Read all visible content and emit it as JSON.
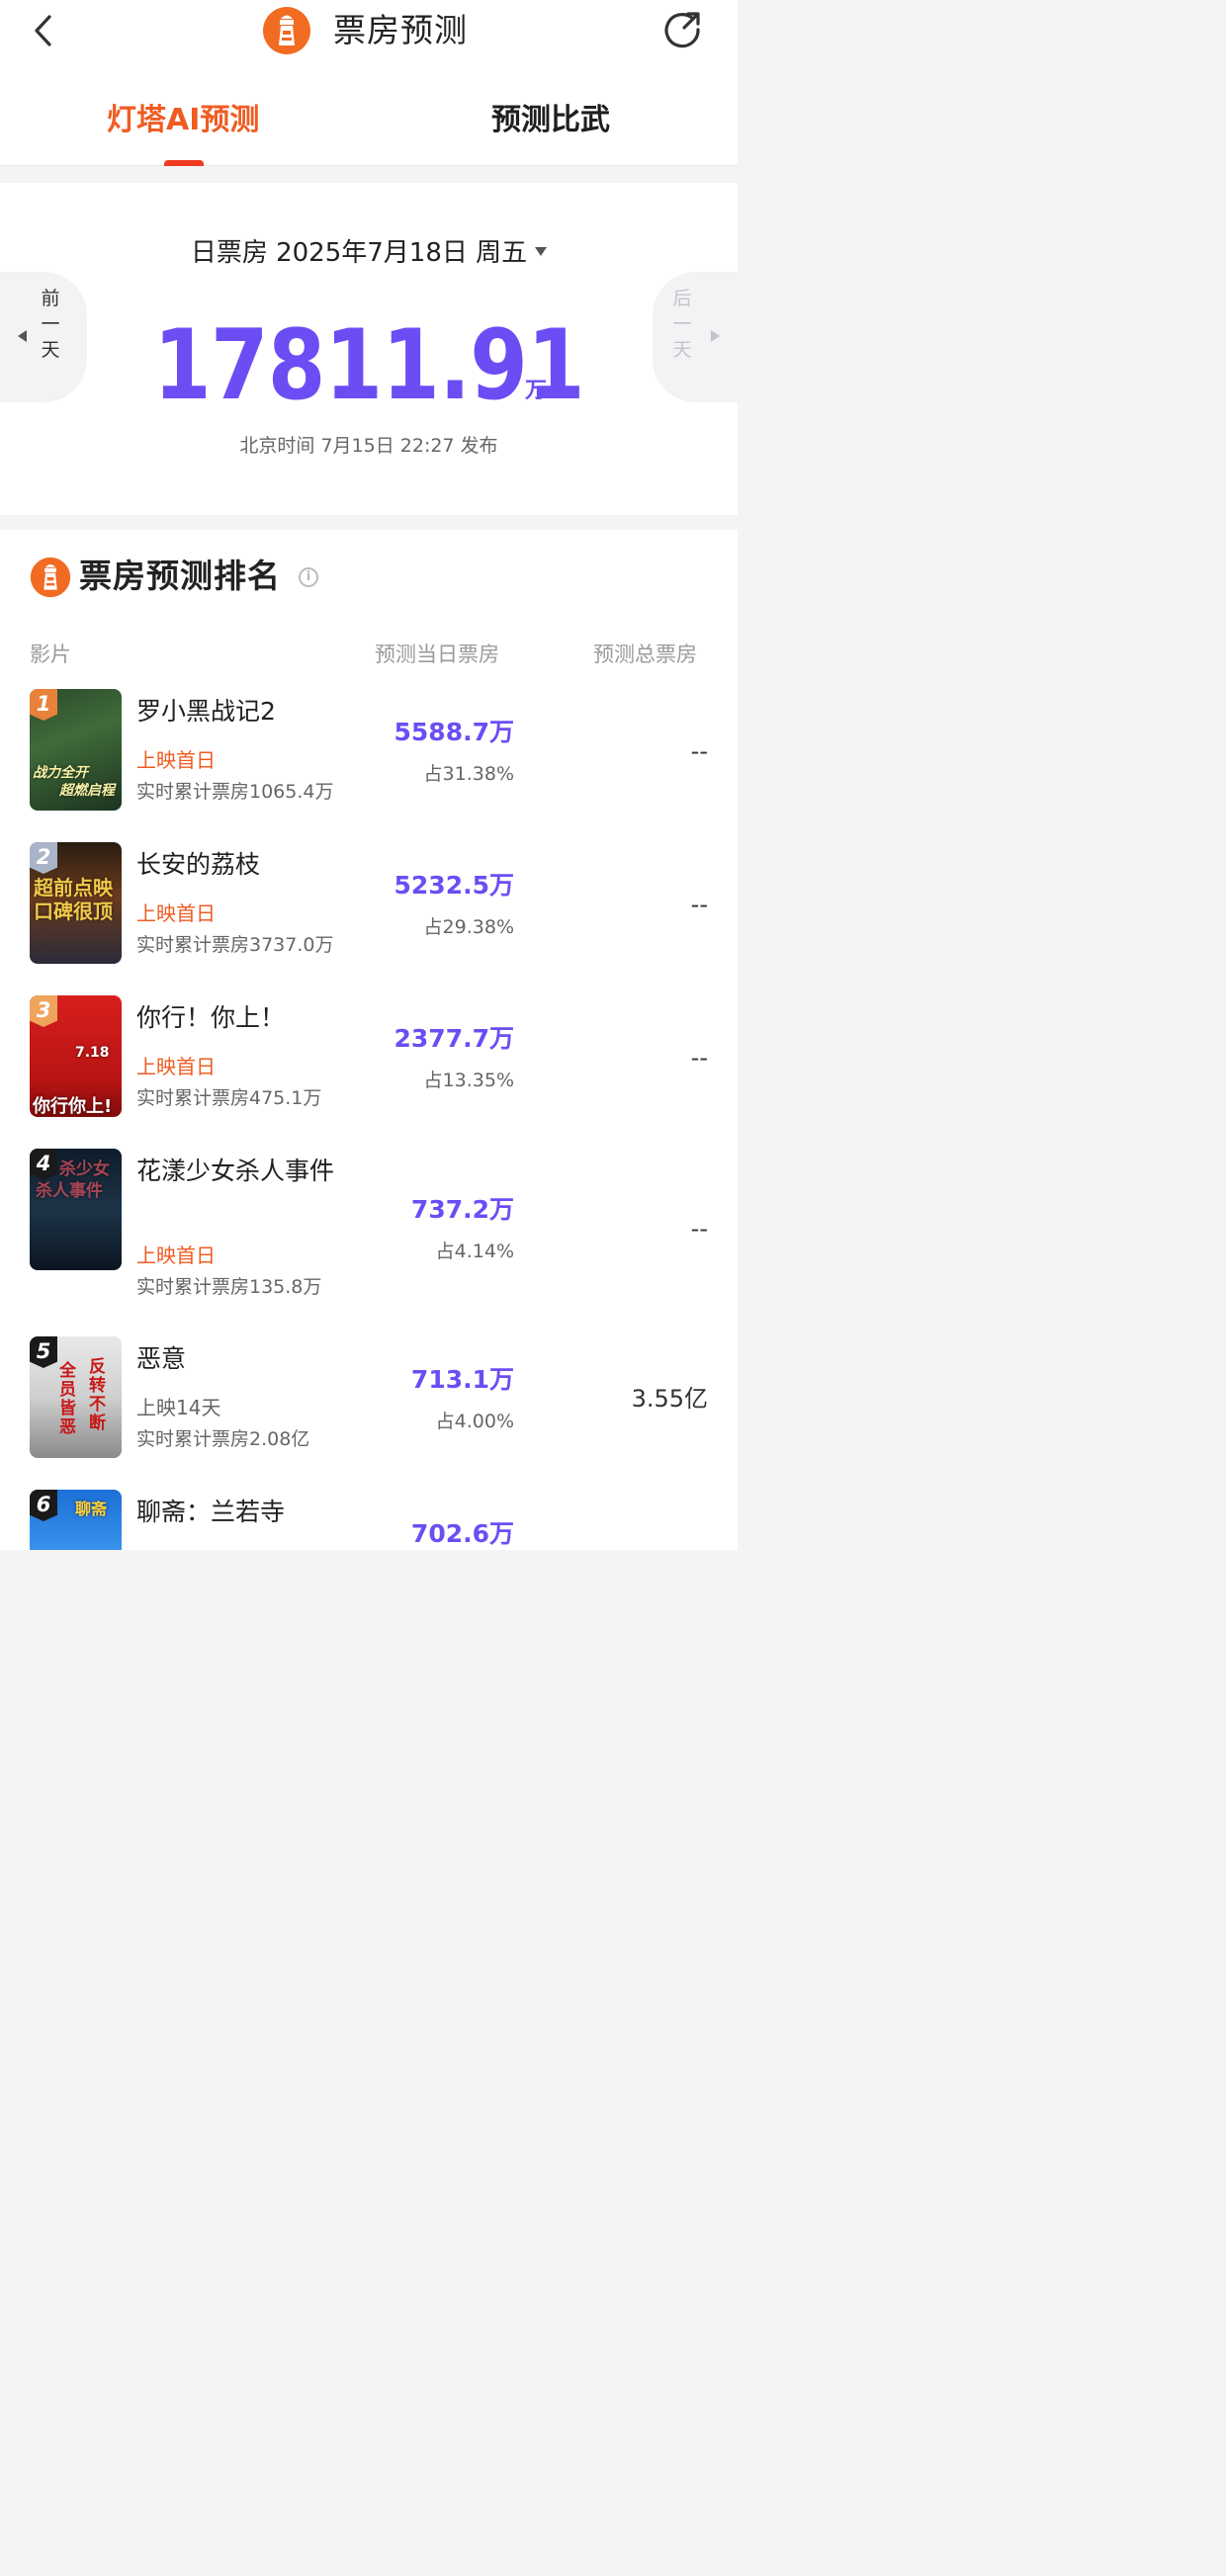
{
  "header": {
    "title": "票房预测",
    "back_icon": "chevron-left-icon",
    "share_icon": "share-icon",
    "brand_color": "#f26b22"
  },
  "tabs": [
    {
      "label": "灯塔AI预测",
      "active": true
    },
    {
      "label": "预测比武",
      "active": false
    }
  ],
  "summary": {
    "date_label": "日票房 2025年7月18日 周五",
    "prev_day": [
      "前",
      "一",
      "天"
    ],
    "next_day": [
      "后",
      "一",
      "天"
    ],
    "total": "17811.91",
    "unit": "万",
    "publish_time": "北京时间 7月15日 22:27 发布",
    "accent_color": "#6c4df4"
  },
  "ranking": {
    "title": "票房预测排名",
    "columns": {
      "film": "影片",
      "day_box_office": "预测当日票房",
      "total_box_office": "预测总票房"
    },
    "films": [
      {
        "rank": "1",
        "name": "罗小黑战记2",
        "status": "上映首日",
        "status_highlight": true,
        "cumulative": "实时累计票房1065.4万",
        "day_value": "5588.7万",
        "share": "占31.38%",
        "total": "--",
        "poster_text": [
          "战力全开",
          "超燃启程"
        ]
      },
      {
        "rank": "2",
        "name": "长安的荔枝",
        "status": "上映首日",
        "status_highlight": true,
        "cumulative": "实时累计票房3737.0万",
        "day_value": "5232.5万",
        "share": "占29.38%",
        "total": "--",
        "poster_text": [
          "超前点映",
          "口碑很顶"
        ]
      },
      {
        "rank": "3",
        "name": "你行！你上！",
        "status": "上映首日",
        "status_highlight": true,
        "cumulative": "实时累计票房475.1万",
        "day_value": "2377.7万",
        "share": "占13.35%",
        "total": "--",
        "poster_text": [
          "7.18",
          "你行你上!"
        ]
      },
      {
        "rank": "4",
        "name": "花漾少女杀人事件",
        "status": "上映首日",
        "status_highlight": true,
        "cumulative": "实时累计票房135.8万",
        "day_value": "737.2万",
        "share": "占4.14%",
        "total": "--",
        "poster_text": [
          "杀少女",
          "杀人事件"
        ]
      },
      {
        "rank": "5",
        "name": "恶意",
        "status": "上映14天",
        "status_highlight": false,
        "cumulative": "实时累计票房2.08亿",
        "day_value": "713.1万",
        "share": "占4.00%",
        "total": "3.55亿",
        "poster_text": [
          "反转不断",
          "全员皆恶"
        ]
      },
      {
        "rank": "6",
        "name": "聊斋：兰若寺",
        "status": "",
        "status_highlight": false,
        "cumulative": "",
        "day_value": "702.6万",
        "share": "",
        "total": "",
        "poster_text": [
          "聊斋"
        ]
      }
    ]
  }
}
